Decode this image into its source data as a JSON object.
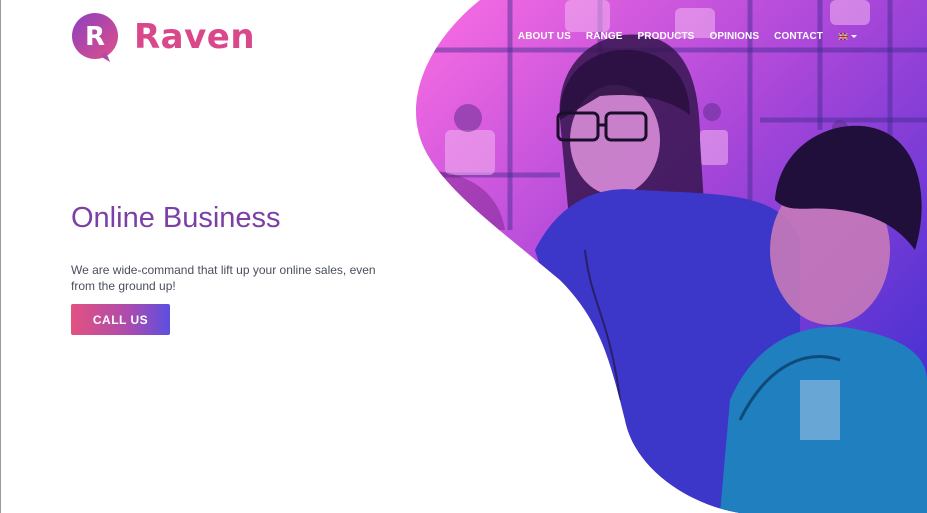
{
  "brand": {
    "name": "Raven",
    "logo_letter": "R"
  },
  "nav": {
    "items": [
      "ABOUT US",
      "RANGE",
      "PRODUCTS",
      "OPINIONS",
      "CONTACT"
    ],
    "language": "en-flag-icon"
  },
  "hero": {
    "title": "Online Business",
    "text": "We are wide-command that lift up your online sales, even from the ground up!",
    "cta_label": "CALL US"
  },
  "colors": {
    "brand_pink": "#d9488a",
    "title_purple": "#7b3fa6",
    "gradient_start": "#e25181",
    "gradient_end": "#5d4ee0",
    "overlay_magenta": "#e35ad8",
    "overlay_blue": "#2b2bd0"
  }
}
